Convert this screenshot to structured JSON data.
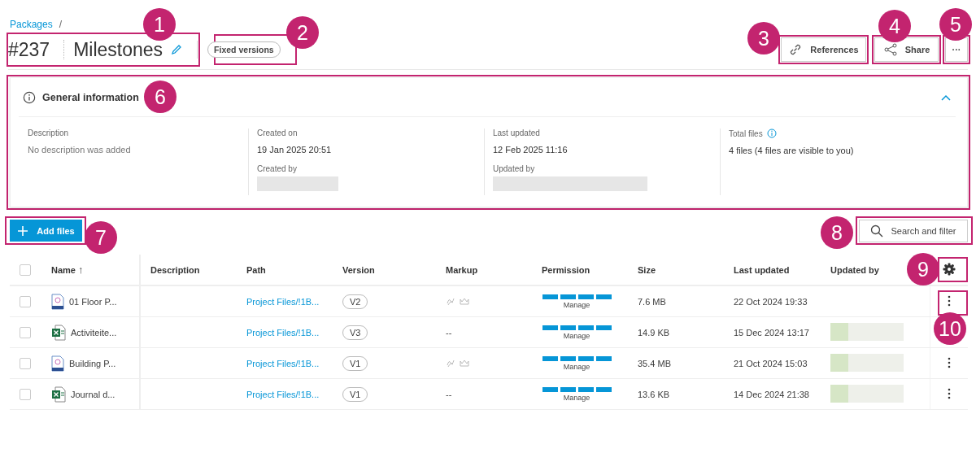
{
  "breadcrumb": {
    "link": "Packages",
    "separator": "/"
  },
  "header": {
    "number": "#237",
    "title": "Milestones",
    "badge": "Fixed versions",
    "buttons": [
      {
        "kind": "link",
        "label": "References"
      },
      {
        "kind": "share",
        "label": "Share"
      },
      {
        "kind": "more",
        "label": "···"
      }
    ]
  },
  "info": {
    "title": "General information",
    "expanded": true,
    "fields": [
      {
        "label": "Description",
        "value": "No description was added",
        "muted": true
      },
      {
        "label": "Created on",
        "value": "19 Jan 2025 20:51",
        "sub_label": "Created by"
      },
      {
        "label": "Last updated",
        "value": "12 Feb 2025 11:16",
        "sub_label": "Updated by"
      },
      {
        "label": "Total files",
        "value": "4 files (4 files are visible to you)",
        "info_icon": true
      }
    ]
  },
  "toolbar": {
    "add_button": "Add files",
    "search_button": "Search and filter"
  },
  "table": {
    "select_all_checked": false,
    "columns": [
      "Name",
      "Description",
      "Path",
      "Version",
      "Markup",
      "Permission",
      "Size",
      "Last updated",
      "Updated by"
    ],
    "sort_arrow": "↑",
    "rows": [
      {
        "kind": "ifc",
        "checked": false,
        "name": "01 Floor P...",
        "path": "Project Files/!1B...",
        "version": "V2",
        "markup": {
          "kind": "icons"
        },
        "permission": {
          "level": 1,
          "label": "Manage"
        },
        "size": "7.6 MB",
        "updated": "22 Oct 2024 19:33",
        "updated_by_redacted": false
      },
      {
        "kind": "sheet",
        "checked": false,
        "name": "Activiteite...",
        "path": "Project Files/!1B...",
        "version": "V3",
        "markup": {
          "kind": "text",
          "text": "--"
        },
        "permission": {
          "level": 1,
          "label": "Manage"
        },
        "size": "14.9 KB",
        "updated": "15 Dec 2024 13:17",
        "updated_by_redacted": true
      },
      {
        "kind": "ifc",
        "checked": false,
        "name": "Building P...",
        "path": "Project Files/!1B...",
        "version": "V1",
        "markup": {
          "kind": "icons"
        },
        "permission": {
          "level": 1,
          "label": "Manage"
        },
        "size": "35.4 MB",
        "updated": "21 Oct 2024 15:03",
        "updated_by_redacted": true
      },
      {
        "kind": "sheet",
        "checked": false,
        "name": "Journal d...",
        "path": "Project Files/!1B...",
        "version": "V1",
        "markup": {
          "kind": "text",
          "text": "--"
        },
        "permission": {
          "level": 1,
          "label": "Manage"
        },
        "size": "13.6 KB",
        "updated": "14 Dec 2024 21:38",
        "updated_by_redacted": true
      }
    ]
  },
  "callouts": [
    {
      "label": "1"
    },
    {
      "label": "2"
    },
    {
      "label": "3"
    },
    {
      "label": "4"
    },
    {
      "label": "5"
    },
    {
      "label": "6"
    },
    {
      "label": "7"
    },
    {
      "label": "8"
    },
    {
      "label": "9"
    },
    {
      "label": "10"
    }
  ]
}
